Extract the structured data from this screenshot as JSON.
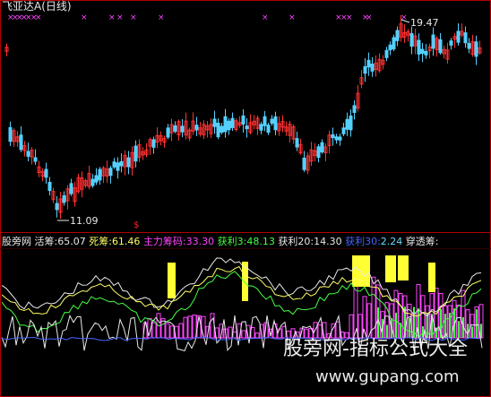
{
  "header": {
    "stock_name": "飞亚达A",
    "period": "(日线)"
  },
  "price_chart": {
    "high_label": "19.47",
    "low_label": "11.09",
    "signal_glyph": "$",
    "colors": {
      "up": "#ff3030",
      "down": "#54d0ff",
      "marker": "#ff44ff"
    }
  },
  "indicator_bar": {
    "site": "股旁网",
    "items": [
      {
        "label": "活筹:",
        "value": "65.07",
        "color": "#e8e8e8"
      },
      {
        "label": "死筹:",
        "value": "61.46",
        "color": "#ffff66"
      },
      {
        "label": "主力筹码:",
        "value": "33.30",
        "color": "#ff44ff"
      },
      {
        "label": "获利3:",
        "value": "48.13",
        "color": "#44ff44"
      },
      {
        "label": "获利20:",
        "value": "14.30",
        "color": "#e8e8e8"
      },
      {
        "label": "获利30:",
        "value": "2.24",
        "color": "#4466ff"
      },
      {
        "label": "穿透筹:",
        "value": "",
        "color": "#e8e8e8"
      }
    ]
  },
  "watermark": {
    "line1": "股旁网-指标公式大全",
    "line2": "www.gupang.com"
  }
}
